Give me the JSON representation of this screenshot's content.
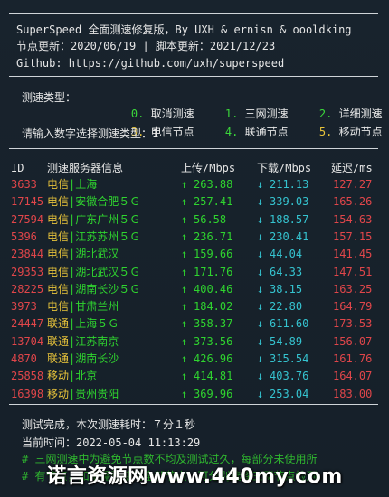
{
  "header": {
    "title_line": "SuperSpeed 全面测速修复版，By UXH & ernisn & oooldking",
    "node_update": "节点更新：2020/06/19 | 脚本更新：2021/12/23",
    "github": "Github: https://github.com/uxh/superspeed"
  },
  "menu": {
    "label": "测速类型：",
    "options": [
      {
        "num": "0.",
        "text": "取消测速"
      },
      {
        "num": "1.",
        "text": "三网测速"
      },
      {
        "num": "2.",
        "text": "详细测速"
      },
      {
        "num": "3.",
        "text": "电信节点"
      },
      {
        "num": "4.",
        "text": "联通节点"
      },
      {
        "num": "5.",
        "text": "移动节点"
      }
    ],
    "prompt": "请输入数字选择测速类型：1"
  },
  "table": {
    "headers": {
      "id": "ID",
      "server": "测速服务器信息",
      "up": "上传/Mbps",
      "down": "下载/Mbps",
      "latency": "延迟/ms"
    },
    "arrow_up": "↑",
    "arrow_down": "↓",
    "rows": [
      {
        "id": "3633",
        "isp": "电信",
        "loc": "|上海",
        "up": "263.88",
        "down": "211.13",
        "lat": "127.27"
      },
      {
        "id": "17145",
        "isp": "电信",
        "loc": "|安徽合肥５Ｇ",
        "up": "257.41",
        "down": "339.03",
        "lat": "165.26"
      },
      {
        "id": "27594",
        "isp": "电信",
        "loc": "|广东广州５Ｇ",
        "up": "56.58",
        "down": "188.57",
        "lat": "154.63"
      },
      {
        "id": "5396",
        "isp": "电信",
        "loc": "|江苏苏州５Ｇ",
        "up": "236.71",
        "down": "230.41",
        "lat": "157.15"
      },
      {
        "id": "23844",
        "isp": "电信",
        "loc": "|湖北武汉",
        "up": "159.66",
        "down": "44.04",
        "lat": "141.45"
      },
      {
        "id": "29353",
        "isp": "电信",
        "loc": "|湖北武汉５Ｇ",
        "up": "171.76",
        "down": "64.33",
        "lat": "147.51"
      },
      {
        "id": "28225",
        "isp": "电信",
        "loc": "|湖南长沙５Ｇ",
        "up": "400.46",
        "down": "38.15",
        "lat": "163.25"
      },
      {
        "id": "3973",
        "isp": "电信",
        "loc": "|甘肃兰州",
        "up": "184.02",
        "down": "22.80",
        "lat": "164.79"
      },
      {
        "id": "24447",
        "isp": "联通",
        "loc": "|上海５Ｇ",
        "up": "358.37",
        "down": "611.60",
        "lat": "173.53"
      },
      {
        "id": "13704",
        "isp": "联通",
        "loc": "|江苏南京",
        "up": "373.56",
        "down": "54.89",
        "lat": "156.07"
      },
      {
        "id": "4870",
        "isp": "联通",
        "loc": "|湖南长沙",
        "up": "426.96",
        "down": "315.54",
        "lat": "161.76"
      },
      {
        "id": "25858",
        "isp": "移动",
        "loc": "|北京",
        "up": "414.81",
        "down": "403.76",
        "lat": "164.07"
      },
      {
        "id": "16398",
        "isp": "移动",
        "loc": "|贵州贵阳",
        "up": "369.96",
        "down": "253.04",
        "lat": "183.00"
      }
    ]
  },
  "footer": {
    "done": "测试完成，本次测速耗时：７分１秒",
    "time": "当前时间：2022-05-04 11:13:29",
    "comment1": "# 三网测速中为避免节点数不均及测试过久，每部分未使用所",
    "comment2": "# 有节点，如果需要使用全部节点，可分别选择三网节点检测"
  },
  "watermark": "诺言资源网www.440my.com",
  "colors": {
    "background": "#17222c",
    "id": "#e0464a",
    "isp": "#e6c23a",
    "location": "#2fd42f",
    "upload": "#2fd42f",
    "download": "#35c4d0",
    "latency": "#e0464a"
  }
}
